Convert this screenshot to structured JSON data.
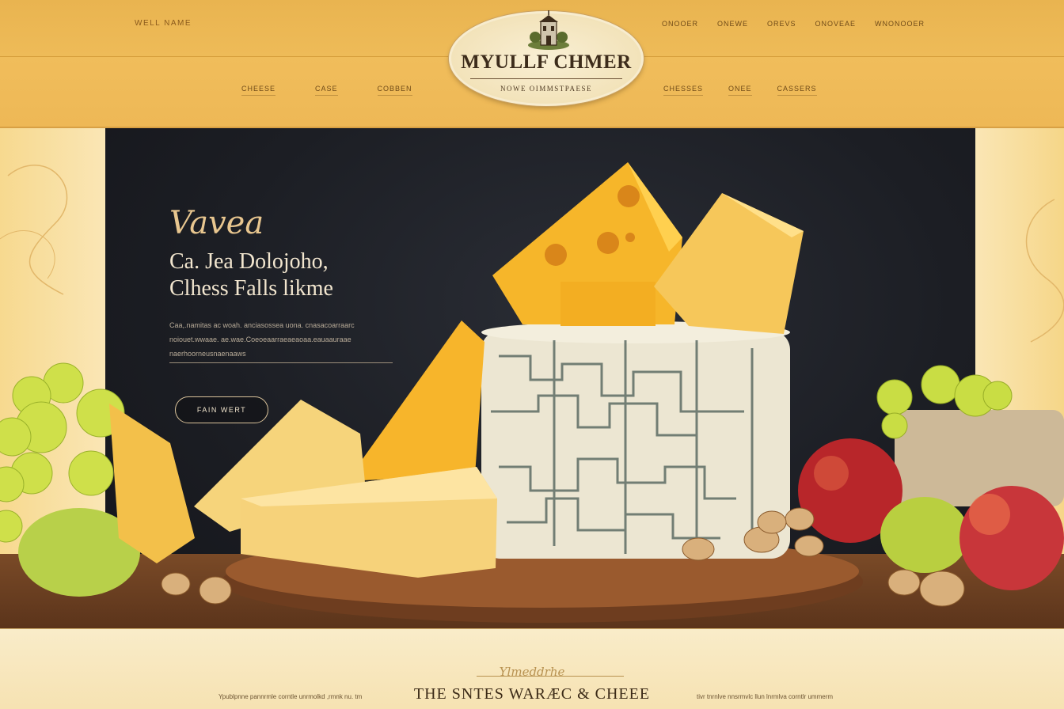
{
  "header": {
    "tagline": "WELL NAME",
    "utility_nav": [
      "ONOOER",
      "ONEWE",
      "OREVS",
      "ONOVEAE",
      "WNONOOER"
    ],
    "main_nav_left": [
      "CHEESE",
      "CASE",
      "COBBEN"
    ],
    "main_nav_right": [
      "CHESSES",
      "ONEE",
      "CASSERS"
    ]
  },
  "logo": {
    "title": "MYULLF CHMER",
    "subtitle": "NOWE OIMMSTPAESE"
  },
  "hero": {
    "script_title": "Vavea",
    "heading_lines": [
      "Ca. Jea Dolojoho,",
      "Clhess Falls likme"
    ],
    "body_lines": [
      "Caa,.namitas ac woah. anciasossea uona. cnasacoarraarc",
      "noiouet.wwaae. ae.wae.Coeoeaarraeaeaoaa.eauaauraae",
      "naerhoorneusnaenaaws"
    ],
    "cta_label": "FAIN WERT"
  },
  "footer": {
    "script_text": "Ylmeddrhe",
    "title": "THE SNTES WARÆC & CHEEE",
    "note_left": "Ypublpnne pannrmle corntle unrmolkd ,rmnk nu. tm",
    "note_right": "tivr tnrnlve nnsrmvlc llun lnrmlva corntlr ummerm"
  },
  "colors": {
    "header_gold": "#eebb58",
    "hero_dark": "#1c1e24",
    "cream": "#f6e6c0",
    "cheese_yellow": "#f4b52a",
    "text_dark": "#3a2a14"
  }
}
